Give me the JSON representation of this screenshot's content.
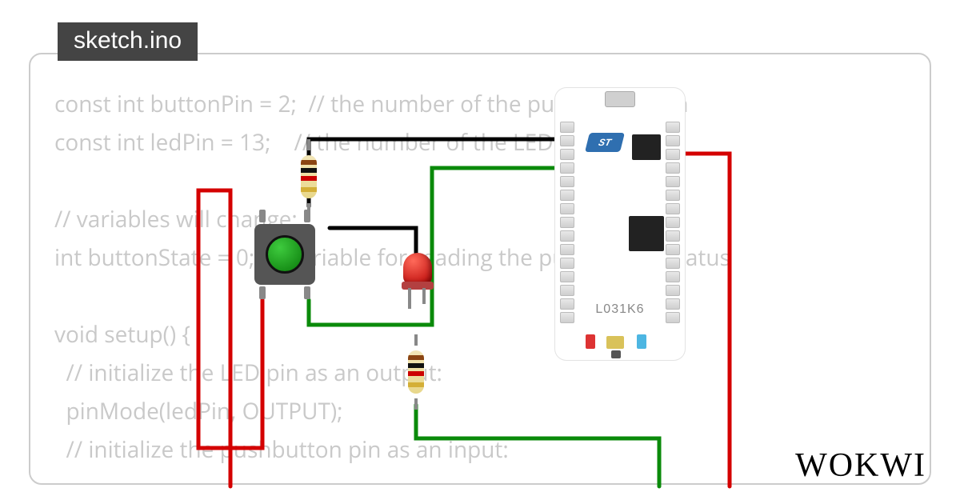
{
  "tab": {
    "filename": "sketch.ino"
  },
  "code": {
    "text": "const int buttonPin = 2;  // the number of the pushbutton pin\nconst int ledPin = 13;    // the number of the LED pin\n\n// variables will change:\nint buttonState = 0;  // variable for reading the pushbutton status\n\nvoid setup() {\n  // initialize the LED pin as an output:\n  pinMode(ledPin, OUTPUT);\n  // initialize the pushbutton pin as an input:"
  },
  "board": {
    "brand": "ST",
    "model": "L031K6"
  },
  "components": {
    "pushbutton": {
      "color": "green"
    },
    "led": {
      "color": "red"
    },
    "resistor1": {
      "position": "top-vertical"
    },
    "resistor2": {
      "position": "below-led"
    }
  },
  "wires": {
    "colors": {
      "power": "#d40000",
      "signal": "#0a8a0a",
      "ground": "#000000"
    }
  },
  "branding": {
    "name": "WOKWI"
  }
}
